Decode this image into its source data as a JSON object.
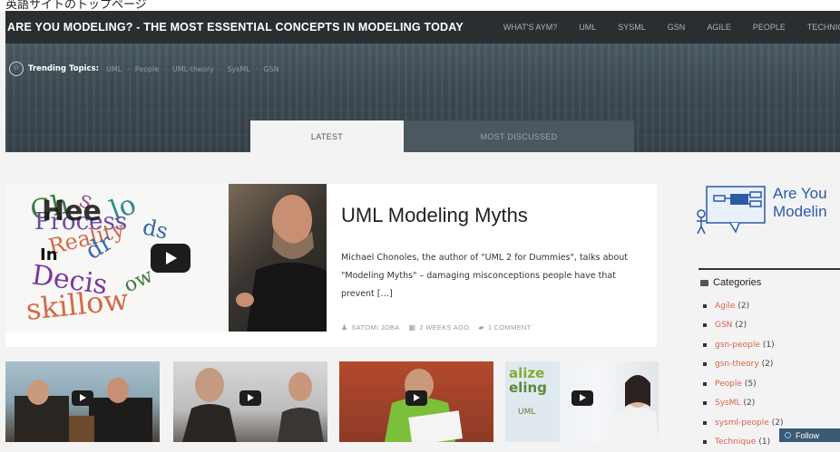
{
  "caption": "英語サイトのトップページ",
  "header": {
    "site_title": "ARE YOU MODELING? - THE MOST ESSENTIAL CONCEPTS IN MODELING TODAY",
    "nav": [
      "WHAT'S AYM?",
      "UML",
      "SYSML",
      "GSN",
      "AGILE",
      "PEOPLE",
      "TECHNIQUE"
    ]
  },
  "trending": {
    "label": "Trending Topics:",
    "topics": [
      "UML",
      "People",
      "UML-theory",
      "SysML",
      "GSN"
    ],
    "separator": "·"
  },
  "tabs": {
    "latest": "LATEST",
    "most_discussed": "MOST DISCUSSED"
  },
  "featured": {
    "title": "UML Modeling Myths",
    "excerpt": "Michael Chonoles, the author of \"UML 2 for Dummies\", talks about \"Modeling Myths\" – damaging misconceptions people have that prevent […]",
    "author": "SATOMI JOBA",
    "date": "2 WEEKS AGO",
    "comments": "1 COMMENT"
  },
  "sidebar": {
    "logo_line1": "Are You",
    "logo_line2": "Modelin",
    "categories_heading": "Categories",
    "categories": [
      {
        "name": "Agile",
        "count": "(2)"
      },
      {
        "name": "GSN",
        "count": "(2)"
      },
      {
        "name": "gsn-people",
        "count": "(1)"
      },
      {
        "name": "gsn-theory",
        "count": "(2)"
      },
      {
        "name": "People",
        "count": "(5)"
      },
      {
        "name": "SysML",
        "count": "(2)"
      },
      {
        "name": "sysml-people",
        "count": "(2)"
      },
      {
        "name": "Technique",
        "count": "(1)"
      }
    ]
  },
  "follow": {
    "label": "Follow"
  },
  "colors": {
    "accent_link": "#d9634a",
    "topbar": "#2a2e31",
    "follow_bg": "#3b5a76",
    "logo_blue": "#2b5aa8"
  },
  "icons": [
    "star-icon",
    "play-icon",
    "user-icon",
    "calendar-icon",
    "comment-icon",
    "folder-icon",
    "follow-icon"
  ]
}
